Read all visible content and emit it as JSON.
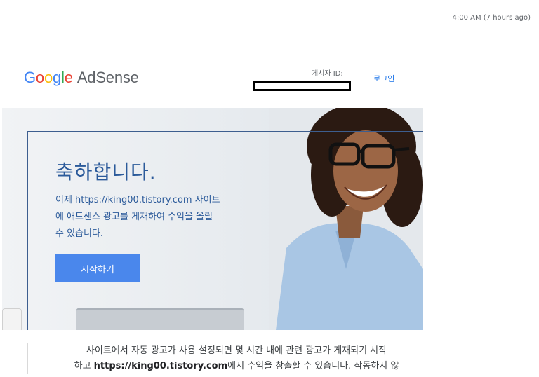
{
  "email": {
    "timestamp": "4:00 AM (7 hours ago)"
  },
  "header": {
    "logo_google": "Google",
    "logo_product": "AdSense",
    "publisher_label": "게시자 ID:",
    "login_label": "로그인"
  },
  "hero": {
    "title": "축하합니다.",
    "body": "이제 https://king00.tistory.com 사이트에 애드센스 광고를 게재하여 수익을 올릴 수 있습니다.",
    "button_label": "시작하기"
  },
  "content": {
    "line1": "사이트에서 자동 광고가 사용 설정되면 몇 시간 내에 관련 광고가 게재되기 시작",
    "line2_prefix": "하고 ",
    "line2_link": "https://king00.tistory.com",
    "line2_suffix": "에서 수익을 창출할 수 있습니다. 작동하지 않"
  },
  "colors": {
    "accent_blue": "#4a87ec",
    "title_blue": "#2b5a9a",
    "frame_blue": "#3d5e8f"
  }
}
